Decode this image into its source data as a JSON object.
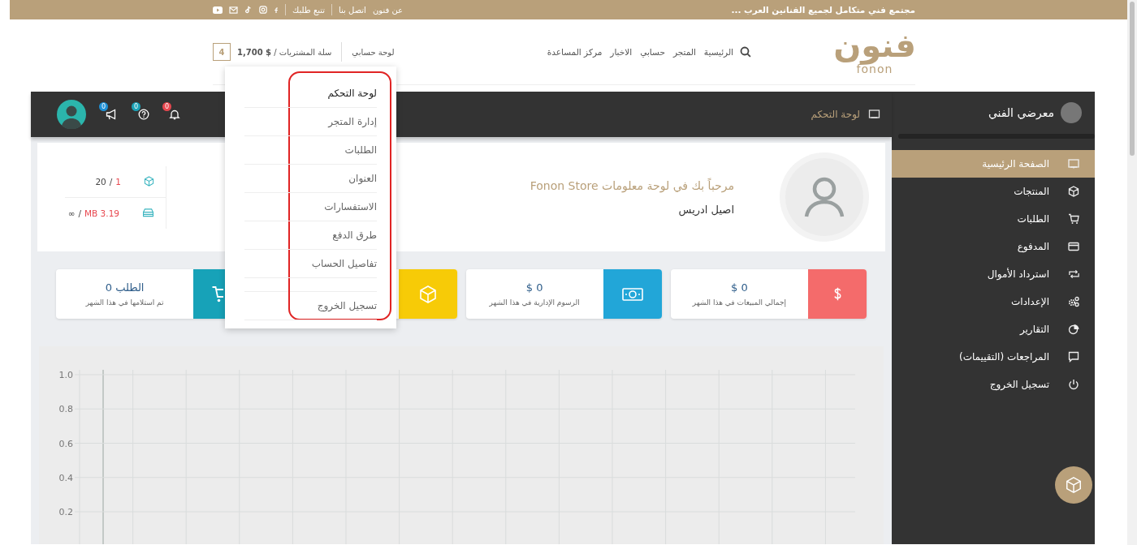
{
  "top_bar": {
    "tagline": "مجتمع فني متكامل لجميع الفنانين العرب ...",
    "links": [
      "عن فنون",
      "اتصل بنا",
      "تتبع طلبك"
    ]
  },
  "header": {
    "logo": {
      "text": "فنون",
      "subtitle": "fonon"
    },
    "nav": [
      "الرئيسية",
      "المتجر",
      "حسابي",
      "الاخبار",
      "مركز المساعدة"
    ],
    "account_link": "لوحة حسابي",
    "cart": {
      "text": "سلة المشتريات / **$ 1,700**",
      "count": "4"
    }
  },
  "account_menu": {
    "items": [
      {
        "kind": "link",
        "label": "لوحة التحكم",
        "selected": true
      },
      {
        "kind": "link",
        "label": "إدارة المتجر",
        "selected": false
      },
      {
        "kind": "link",
        "label": "الطلبات",
        "selected": false
      },
      {
        "kind": "link",
        "label": "العنوان",
        "selected": false
      },
      {
        "kind": "link",
        "label": "الاستفسارات",
        "selected": false
      },
      {
        "kind": "link",
        "label": "طرق الدفع",
        "selected": false
      },
      {
        "kind": "link",
        "label": "تفاصيل الحساب",
        "selected": false
      },
      {
        "kind": "spacer"
      },
      {
        "kind": "link",
        "label": "تسجيل الخروج",
        "selected": false
      }
    ]
  },
  "sidebar": {
    "title": "معرضي الفني",
    "items": [
      {
        "label": "الصفحة الرئيسية",
        "selected": true
      },
      {
        "label": "المنتجات",
        "selected": false
      },
      {
        "label": "الطلبات",
        "selected": false
      },
      {
        "label": "المدفوع",
        "selected": false
      },
      {
        "label": "استرداد الأموال",
        "selected": false
      },
      {
        "label": "الإعدادات",
        "selected": false
      },
      {
        "label": "التقارير",
        "selected": false
      },
      {
        "label": "المراجعات (التقييمات)",
        "selected": false
      },
      {
        "label": "تسجيل الخروج",
        "selected": false
      }
    ]
  },
  "dashboard_bar": {
    "title": "لوحة التحكم",
    "notifications": [
      {
        "count": "0",
        "color": "#e8474f"
      },
      {
        "count": "0",
        "color": "#1aa3b8"
      },
      {
        "count": "0",
        "color": "#1e90d6"
      }
    ]
  },
  "welcome": {
    "greeting": "مرحباً بك في لوحة معلومات Fonon Store",
    "name": "اصيل ادريس",
    "usage": [
      {
        "used": "1",
        "separator": "/",
        "limit": "20"
      },
      {
        "used": "MB 3.19",
        "separator": "/",
        "limit": "∞"
      }
    ]
  },
  "stat_cards": [
    {
      "color": "#f46b6b",
      "value": "0 $",
      "label": "إجمالي المبيعات في هذا الشهر"
    },
    {
      "color": "#22a6d8",
      "value": "0 $",
      "label": "الرسوم الإدارية في هذا الشهر"
    },
    {
      "color": "#f7cb07"
    },
    {
      "color": "#17a2b8",
      "value": "الطلب 0",
      "label": "تم استلامها في هذا الشهر"
    }
  ],
  "chart": {
    "y_axis_labels": [
      "1.0",
      "0.8",
      "0.6",
      "0.4",
      "0.2"
    ]
  }
}
